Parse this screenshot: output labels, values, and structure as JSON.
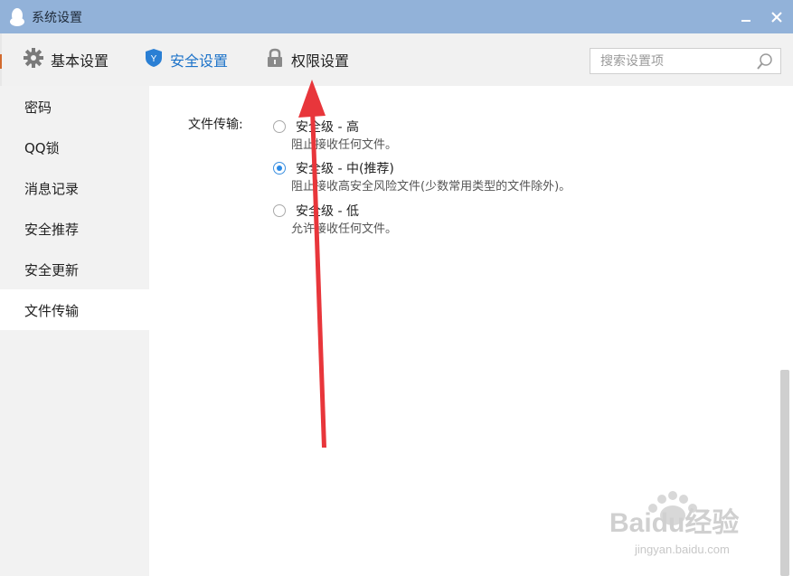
{
  "window": {
    "title": "系统设置"
  },
  "toolbar": {
    "tabs": [
      {
        "label": "基本设置",
        "icon": "gear-icon"
      },
      {
        "label": "安全设置",
        "icon": "shield-icon",
        "active": true
      },
      {
        "label": "权限设置",
        "icon": "lock-icon"
      }
    ],
    "search_placeholder": "搜索设置项"
  },
  "sidebar": {
    "items": [
      {
        "label": "密码"
      },
      {
        "label": "QQ锁"
      },
      {
        "label": "消息记录"
      },
      {
        "label": "安全推荐"
      },
      {
        "label": "安全更新"
      },
      {
        "label": "文件传输",
        "active": true
      }
    ]
  },
  "content": {
    "field_label": "文件传输:",
    "options": [
      {
        "title": "安全级 - 高",
        "desc": "阻止接收任何文件。",
        "checked": false
      },
      {
        "title": "安全级 - 中(推荐)",
        "desc": "阻止接收高安全风险文件(少数常用类型的文件除外)。",
        "checked": true
      },
      {
        "title": "安全级 - 低",
        "desc": "允许接收任何文件。",
        "checked": false
      }
    ]
  },
  "watermark": {
    "brand": "Baidu经验",
    "url": "jingyan.baidu.com"
  },
  "colors": {
    "titlebar": "#92b2d9",
    "accent": "#1d73c9",
    "arrow": "#e8363b"
  }
}
